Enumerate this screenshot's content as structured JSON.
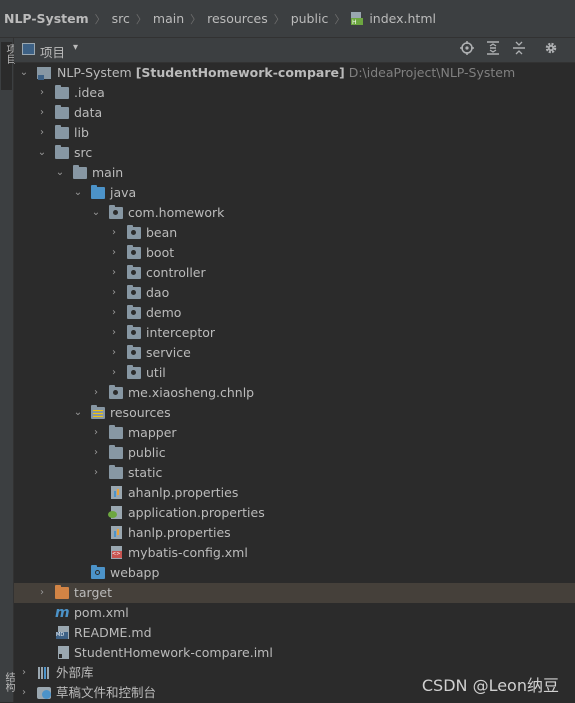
{
  "breadcrumb": {
    "items": [
      "NLP-System",
      "src",
      "main",
      "resources",
      "public"
    ],
    "file": "index.html"
  },
  "tool_stripe": {
    "top_label": "项目",
    "bottom_label": "结构"
  },
  "project_toolbar": {
    "title": "项目",
    "dropdown": "▾",
    "buttons": [
      "locate-icon",
      "expand-all-icon",
      "collapse-all-icon",
      "settings-icon"
    ]
  },
  "tree": {
    "root_name": "NLP-System",
    "root_module": "[StudentHomework-compare]",
    "root_path": "D:\\ideaProject\\NLP-System",
    "rows": [
      {
        "label": ".idea"
      },
      {
        "label": "data"
      },
      {
        "label": "lib"
      },
      {
        "label": "src"
      },
      {
        "label": "main"
      },
      {
        "label": "java"
      },
      {
        "label": "com.homework"
      },
      {
        "label": "bean"
      },
      {
        "label": "boot"
      },
      {
        "label": "controller"
      },
      {
        "label": "dao"
      },
      {
        "label": "demo"
      },
      {
        "label": "interceptor"
      },
      {
        "label": "service"
      },
      {
        "label": "util"
      },
      {
        "label": "me.xiaosheng.chnlp"
      },
      {
        "label": "resources"
      },
      {
        "label": "mapper"
      },
      {
        "label": "public"
      },
      {
        "label": "static"
      },
      {
        "label": "ahanlp.properties"
      },
      {
        "label": "application.properties"
      },
      {
        "label": "hanlp.properties"
      },
      {
        "label": "mybatis-config.xml"
      },
      {
        "label": "webapp"
      },
      {
        "label": "target"
      },
      {
        "label": "pom.xml"
      },
      {
        "label": "README.md"
      },
      {
        "label": "StudentHomework-compare.iml"
      },
      {
        "label": "外部库"
      },
      {
        "label": "草稿文件和控制台"
      }
    ]
  },
  "watermark": "CSDN @Leon纳豆"
}
